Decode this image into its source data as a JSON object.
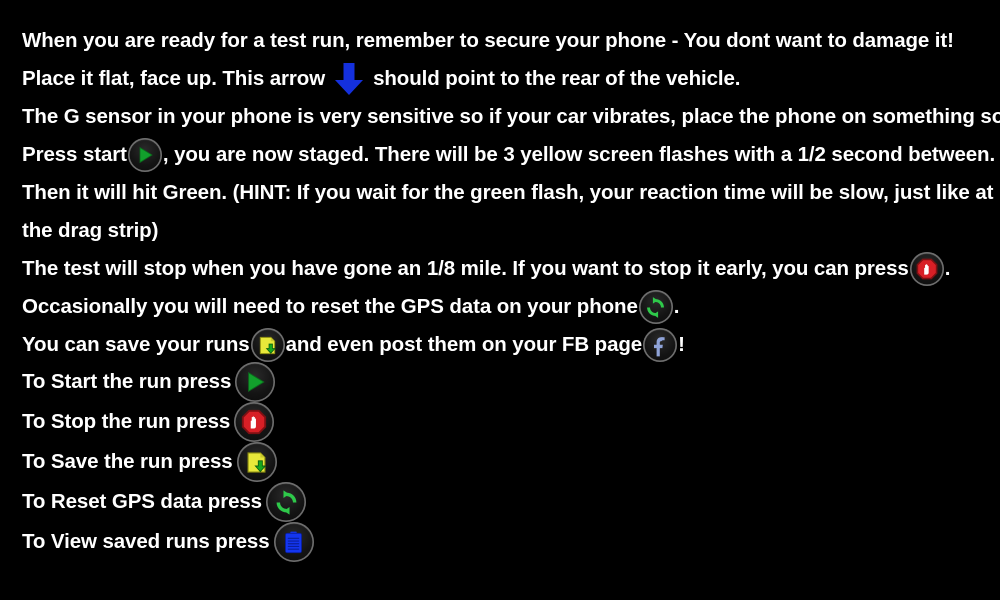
{
  "theme": {
    "background": "#000000",
    "text": "#ffffff",
    "arrow_blue": "#1430dd",
    "start_green": "#12a02c",
    "stop_red": "#d81f26",
    "save_yellow": "#e8e83a",
    "save_arrow_green": "#16a81e",
    "reset_green": "#2ec94a",
    "clipboard_blue": "#1436f0",
    "facebook_blue": "#8fa3d8",
    "icon_ring": "#6e6e6e"
  },
  "instructions": {
    "line1": "When you are ready for a test run, remember to secure your phone - You dont want to damage it!",
    "line2_before": "Place it flat, face up. This arrow",
    "line2_after": "should point to the rear of the vehicle.",
    "line3": "The G sensor in your phone is very sensitive so if your car vibrates, place the phone on something soft.",
    "line4_before": "Press start",
    "line4_after": ", you are now staged. There will be 3 yellow screen flashes with a 1/2 second between.",
    "line5": "Then it will hit Green. (HINT: If you wait for the green flash, your reaction time will be slow, just like at",
    "line6": "the drag strip)",
    "line7_before": "The test will stop when you have gone an 1/8 mile. If you want to stop it early, you can press",
    "line7_after": ".",
    "line8_before": "Occasionally you will need to reset the GPS data on your phone",
    "line8_after": ".",
    "line9_before": "You can save your runs",
    "line9_middle": "and even post them on your FB page",
    "line9_after": "!"
  },
  "legend": [
    {
      "label": "To Start the run press",
      "icon": "start-play-icon"
    },
    {
      "label": "To Stop the run press",
      "icon": "stop-hand-icon"
    },
    {
      "label": "To Save the run press",
      "icon": "save-download-icon"
    },
    {
      "label": "To Reset GPS data press",
      "icon": "reset-refresh-icon"
    },
    {
      "label": "To View saved runs press",
      "icon": "clipboard-view-icon"
    }
  ],
  "icons": {
    "arrow_down": "arrow-down-icon",
    "start": "start-play-icon",
    "stop": "stop-hand-icon",
    "save": "save-download-icon",
    "reset": "reset-refresh-icon",
    "facebook": "facebook-icon",
    "clipboard": "clipboard-view-icon"
  }
}
